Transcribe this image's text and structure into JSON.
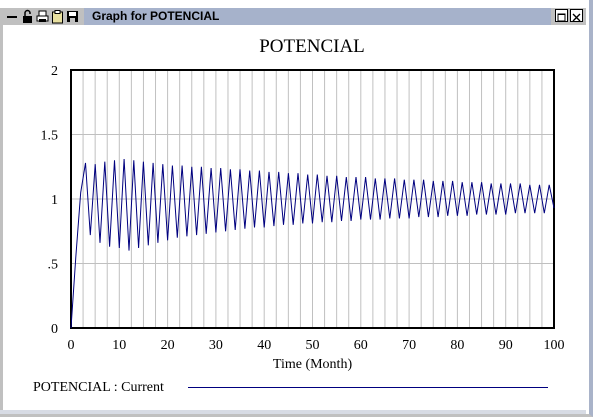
{
  "window": {
    "title": "Graph for POTENCIAL",
    "icons": [
      "minus-icon",
      "lock-icon",
      "print-icon",
      "clipboard-icon",
      "save-icon"
    ],
    "buttons": [
      "restore-button",
      "close-button"
    ]
  },
  "colors": {
    "series": "#00007f",
    "grid": "#c0c0c0",
    "caption_bar": "#a6b2cb",
    "frame": "#c0c0c0"
  },
  "chart_data": {
    "type": "line",
    "title": "POTENCIAL",
    "xlabel": "Time (Month)",
    "ylabel": "",
    "xlim": [
      0,
      100
    ],
    "ylim": [
      0,
      2
    ],
    "xticks": [
      "0",
      "10",
      "20",
      "30",
      "40",
      "50",
      "60",
      "70",
      "80",
      "90",
      "100"
    ],
    "yticks": [
      "0",
      ".5",
      "1",
      "1.5",
      "2"
    ],
    "grid": true,
    "series": [
      {
        "name": "POTENCIAL : Current",
        "color": "#00007f",
        "x": [
          0,
          1,
          2,
          3,
          4,
          5,
          6,
          7,
          8,
          9,
          10,
          11,
          12,
          13,
          14,
          15,
          16,
          17,
          18,
          19,
          20,
          21,
          22,
          23,
          24,
          25,
          26,
          27,
          28,
          29,
          30,
          31,
          32,
          33,
          34,
          35,
          36,
          37,
          38,
          39,
          40,
          41,
          42,
          43,
          44,
          45,
          46,
          47,
          48,
          49,
          50,
          51,
          52,
          53,
          54,
          55,
          56,
          57,
          58,
          59,
          60,
          61,
          62,
          63,
          64,
          65,
          66,
          67,
          68,
          69,
          70,
          71,
          72,
          73,
          74,
          75,
          76,
          77,
          78,
          79,
          80,
          81,
          82,
          83,
          84,
          85,
          86,
          87,
          88,
          89,
          90,
          91,
          92,
          93,
          94,
          95,
          96,
          97,
          98,
          99,
          100
        ],
        "y": [
          0,
          0.55,
          1.05,
          1.28,
          0.72,
          1.27,
          0.66,
          1.29,
          0.63,
          1.3,
          0.62,
          1.31,
          0.6,
          1.3,
          0.62,
          1.29,
          0.64,
          1.28,
          0.66,
          1.27,
          0.68,
          1.26,
          0.7,
          1.26,
          0.71,
          1.25,
          0.72,
          1.25,
          0.73,
          1.24,
          0.74,
          1.24,
          0.75,
          1.23,
          0.76,
          1.23,
          0.77,
          1.22,
          0.78,
          1.22,
          0.78,
          1.21,
          0.79,
          1.21,
          0.8,
          1.2,
          0.8,
          1.2,
          0.81,
          1.19,
          0.81,
          1.19,
          0.82,
          1.18,
          0.82,
          1.18,
          0.83,
          1.17,
          0.83,
          1.17,
          0.84,
          1.17,
          0.84,
          1.16,
          0.84,
          1.16,
          0.85,
          1.16,
          0.85,
          1.15,
          0.85,
          1.15,
          0.86,
          1.15,
          0.86,
          1.14,
          0.86,
          1.14,
          0.87,
          1.14,
          0.87,
          1.13,
          0.87,
          1.13,
          0.88,
          1.13,
          0.88,
          1.12,
          0.88,
          1.12,
          0.88,
          1.12,
          0.89,
          1.12,
          0.89,
          1.11,
          0.89,
          1.11,
          0.89,
          1.11,
          0.93
        ]
      }
    ]
  }
}
